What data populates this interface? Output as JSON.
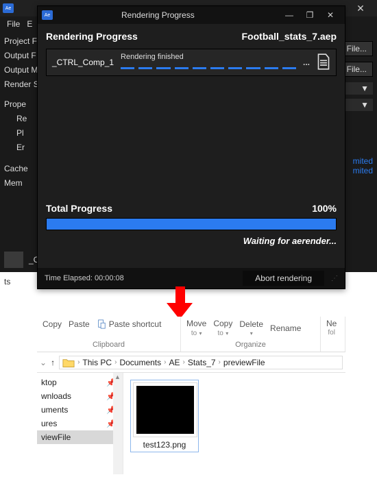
{
  "bg": {
    "app_badge": "Ae",
    "menu": [
      "File",
      "E"
    ],
    "close": "✕",
    "rows": [
      "Project F",
      "Output F",
      "Output M",
      "Render S"
    ],
    "props": "Prope",
    "sub": [
      "Re",
      "Pl",
      "Er"
    ],
    "cache": "Cache",
    "mem": "Mem",
    "file_btn": "e File...",
    "caret": "▼",
    "limited": "mited",
    "bottom_label": "_CTRL_"
  },
  "ts_label": "ts",
  "dlg": {
    "app_badge": "Ae",
    "title": "Rendering Progress",
    "min": "—",
    "max": "❐",
    "close": "✕",
    "heading": "Rendering Progress",
    "project": "Football_stats_7.aep",
    "comp_name": "_CTRL_Comp_1",
    "status": "Rendering finished",
    "dots": "...",
    "total_label": "Total Progress",
    "total_value": "100%",
    "waiting": "Waiting for aerender...",
    "elapsed_label": "Time Elapsed:",
    "elapsed_value": "00:00:08",
    "abort": "Abort rendering"
  },
  "explorer": {
    "ribbon": {
      "copy": "Copy",
      "paste": "Paste",
      "paste_shortcut": "Paste shortcut",
      "clipboard": "Clipboard",
      "move_to": "Move",
      "move_sub": "to",
      "copy_to": "Copy",
      "copy_sub": "to",
      "delete": "Delete",
      "rename": "Rename",
      "new": "Ne",
      "new_sub": "fol",
      "organize": "Organize"
    },
    "nav": {
      "up": "↑",
      "crumbs": [
        "This PC",
        "Documents",
        "AE",
        "Stats_7",
        "previewFile"
      ]
    },
    "side": [
      "ktop",
      "wnloads",
      "uments",
      "ures",
      "viewFile"
    ],
    "file": {
      "name": "test123.png"
    }
  }
}
